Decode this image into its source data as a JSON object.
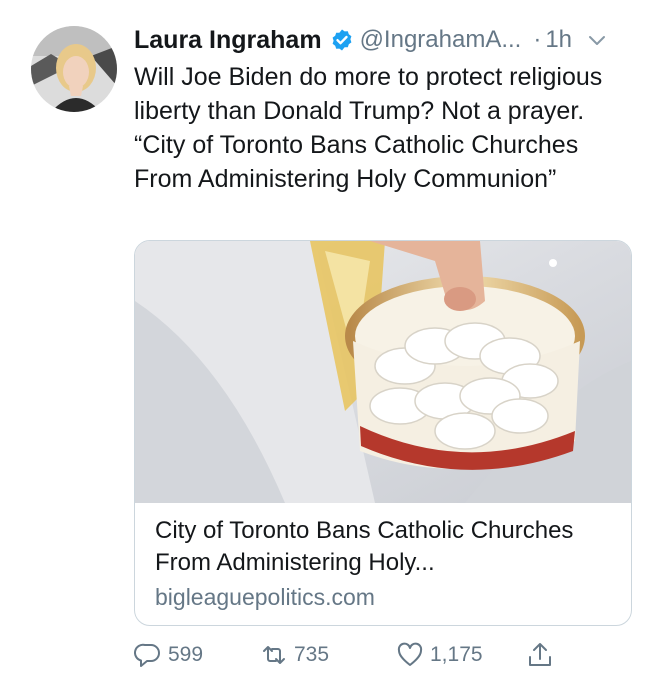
{
  "tweet": {
    "author_name": "Laura Ingraham",
    "handle": "@IngrahamA...",
    "separator": "·",
    "time": "1h",
    "text": "Will Joe Biden do more to protect religious liberty than Donald Trump? Not a prayer. “City of Toronto Bans Catholic Churches From Administering Holy Communion”"
  },
  "card": {
    "title": "City of Toronto Bans Catholic Churches From Administering Holy...",
    "domain": "bigleaguepolitics.com"
  },
  "actions": {
    "reply_count": "599",
    "retweet_count": "735",
    "like_count": "1,175"
  },
  "icons": {
    "verified": "verified-badge-icon",
    "caret": "chevron-down-icon",
    "reply": "reply-icon",
    "retweet": "retweet-icon",
    "like": "heart-icon",
    "share": "share-icon"
  },
  "colors": {
    "verified_blue": "#1da1f2",
    "text": "#14171a",
    "secondary": "#657786",
    "border": "#ccd6dd"
  }
}
